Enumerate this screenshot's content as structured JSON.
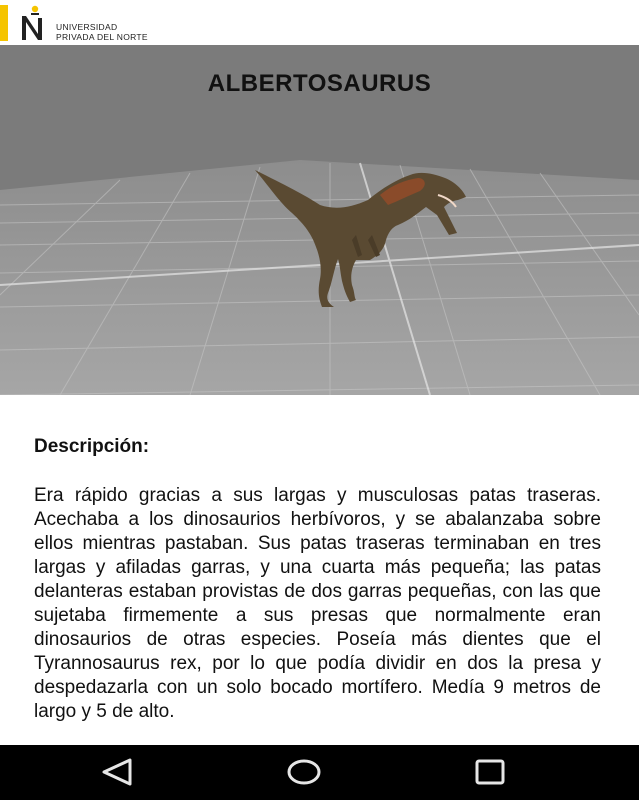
{
  "header": {
    "logo_line1": "UNIVERSIDAD",
    "logo_line2": "PRIVADA DEL NORTE",
    "accent_color": "#f5c400"
  },
  "viewer": {
    "title": "ALBERTOSAURUS",
    "background_color": "#7b7b7b"
  },
  "description": {
    "heading": "Descripción:",
    "body": "Era rápido gracias a sus largas y musculosas patas traseras. Acechaba a los dinosaurios herbívoros, y se abalanzaba sobre ellos mientras pastaban. Sus patas traseras terminaban en tres largas y afiladas garras, y una cuarta más pequeña; las patas delanteras estaban provistas de dos garras pequeñas, con las que sujetaba firmemente a sus presas que normalmente eran dinosaurios de otras especies. Poseía más dientes que el Tyrannosaurus rex, por lo que podía dividir en dos la presa y despedazarla con un solo bocado mortífero. Medía 9 metros de largo y 5 de alto."
  },
  "navbar": {
    "icons": [
      "back-icon",
      "home-icon",
      "recent-apps-icon"
    ]
  }
}
